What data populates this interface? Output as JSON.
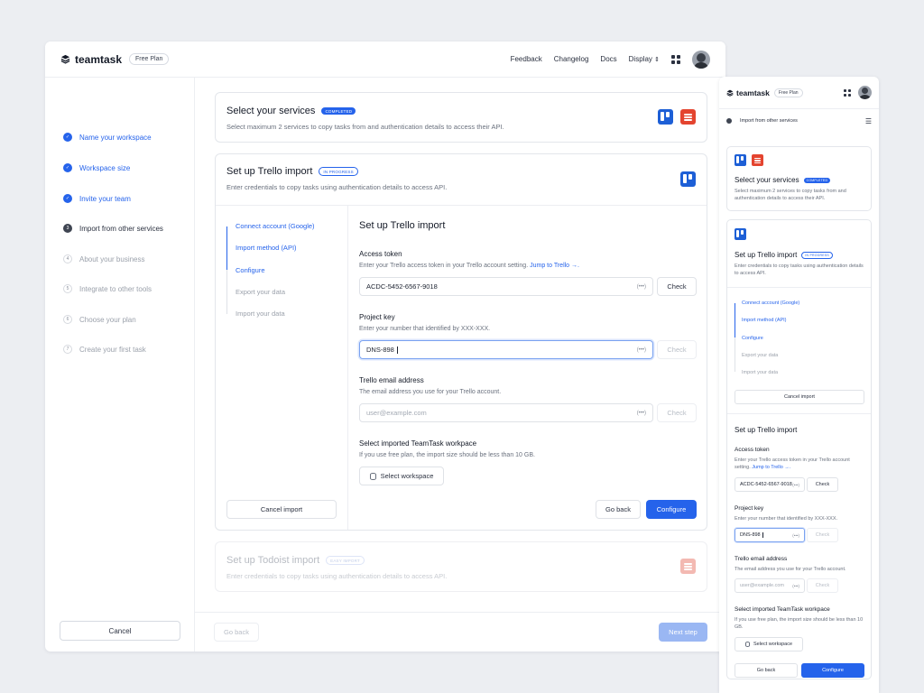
{
  "app": {
    "name": "teamtask",
    "plan_badge": "Free Plan"
  },
  "nav": {
    "feedback": "Feedback",
    "changelog": "Changelog",
    "docs": "Docs",
    "display": "Display"
  },
  "steps": [
    {
      "num": "1",
      "label": "Name your workspace",
      "state": "done"
    },
    {
      "num": "2",
      "label": "Workspace size",
      "state": "done"
    },
    {
      "num": "3",
      "label": "Invite your team",
      "state": "done"
    },
    {
      "num": "3",
      "label": "Import from other services",
      "state": "current"
    },
    {
      "num": "4",
      "label": "About your business",
      "state": "todo"
    },
    {
      "num": "5",
      "label": "Integrate to other tools",
      "state": "todo"
    },
    {
      "num": "6",
      "label": "Choose your plan",
      "state": "todo"
    },
    {
      "num": "7",
      "label": "Create your first task",
      "state": "todo"
    }
  ],
  "sidebar": {
    "cancel_label": "Cancel"
  },
  "services_card": {
    "title": "Select your services",
    "tag": "COMPLETED",
    "subtitle": "Select maximum 2 services to copy tasks from and authentication details to access their API."
  },
  "trello_card": {
    "title": "Set up Trello import",
    "tag": "IN PROGRESS",
    "subtitle": "Enter credentials to copy tasks using authentication details to access API.",
    "substeps": [
      {
        "label": "Connect account (Google)",
        "state": "on"
      },
      {
        "label": "Import method (API)",
        "state": "on"
      },
      {
        "label": "Configure",
        "state": "on"
      },
      {
        "label": "Export your data",
        "state": "off"
      },
      {
        "label": "Import your data",
        "state": "off"
      }
    ],
    "cancel_label": "Cancel import",
    "form": {
      "title": "Set up Trello import",
      "access_token": {
        "label": "Access token",
        "help": "Enter your Trello access token in your Trello account setting.",
        "link": "Jump to Trello →.",
        "value": "ACDC-5452-6567-9018",
        "kbd": "(•••)",
        "check": "Check"
      },
      "project_key": {
        "label": "Project key",
        "help": "Enter your number that identified by XXX-XXX.",
        "value": "DNS-898",
        "kbd": "(•••)",
        "check": "Check"
      },
      "email": {
        "label": "Trello email address",
        "help": "The email address you use for your Trello account.",
        "placeholder": "user@example.com",
        "kbd": "(•••)",
        "check": "Check"
      },
      "workspace": {
        "label": "Select imported TeamTask workpace",
        "help": "If you use free plan, the import size should be less than 10 GB.",
        "button": "Select workspace"
      },
      "go_back": "Go back",
      "configure": "Configure"
    }
  },
  "todoist_card": {
    "title": "Set up Todoist import",
    "tag": "EASY IMPORT",
    "subtitle": "Enter credentials to copy tasks using authentication details to access API."
  },
  "footer": {
    "go_back": "Go back",
    "next_step": "Next step"
  },
  "mobile": {
    "current_step": "Import from other services",
    "services_subtitle": "Select maximum 2 services to copy tasks from and authentication details to access their API.",
    "trello_subtitle": "Enter credentials to copy tasks using authentication details to access API.",
    "access_help": "Enter your Trello access token in your Trello account setting.",
    "email_help": "The email address you use for your Trello account.",
    "workspace_help": "If you use free plan, the import size should be less than 10 GB."
  },
  "colors": {
    "accent": "#2563eb",
    "trello": "#1d5fd6",
    "todoist": "#e4442f"
  }
}
